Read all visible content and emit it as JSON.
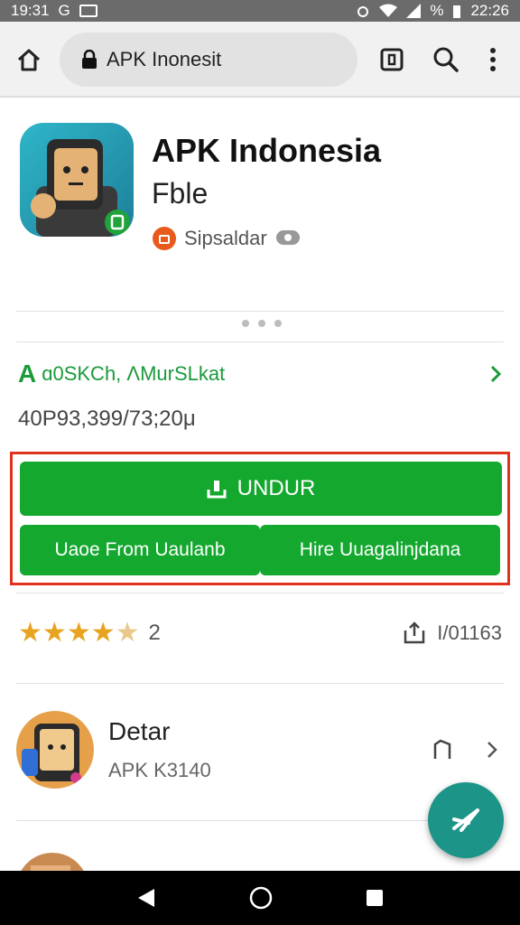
{
  "status_bar": {
    "time": "19:31",
    "g": "G",
    "right_time": "22:26",
    "battery_text": "%"
  },
  "browser": {
    "url": "APK Inonesit"
  },
  "app": {
    "title": "APK Indonesia",
    "subtitle": "Fble",
    "developer": "Sipsaldar"
  },
  "meta": {
    "green_label": "ɑ0SKCh, ΛMurSLkat",
    "version": "40P93,399/73;20μ"
  },
  "buttons": {
    "download": "UNDUR",
    "left": "Uaoe From Uaulanb",
    "right": "Hire Uuagalinjdana"
  },
  "rating": {
    "stars": 4.5,
    "count": "2",
    "downloads": "I/01163"
  },
  "list_item": {
    "title": "Detar",
    "subtitle": "APK K3140"
  },
  "colors": {
    "accent_green": "#14a82f",
    "highlight_red": "#e0321c",
    "fab_teal": "#1d9488",
    "star": "#e8a320"
  }
}
